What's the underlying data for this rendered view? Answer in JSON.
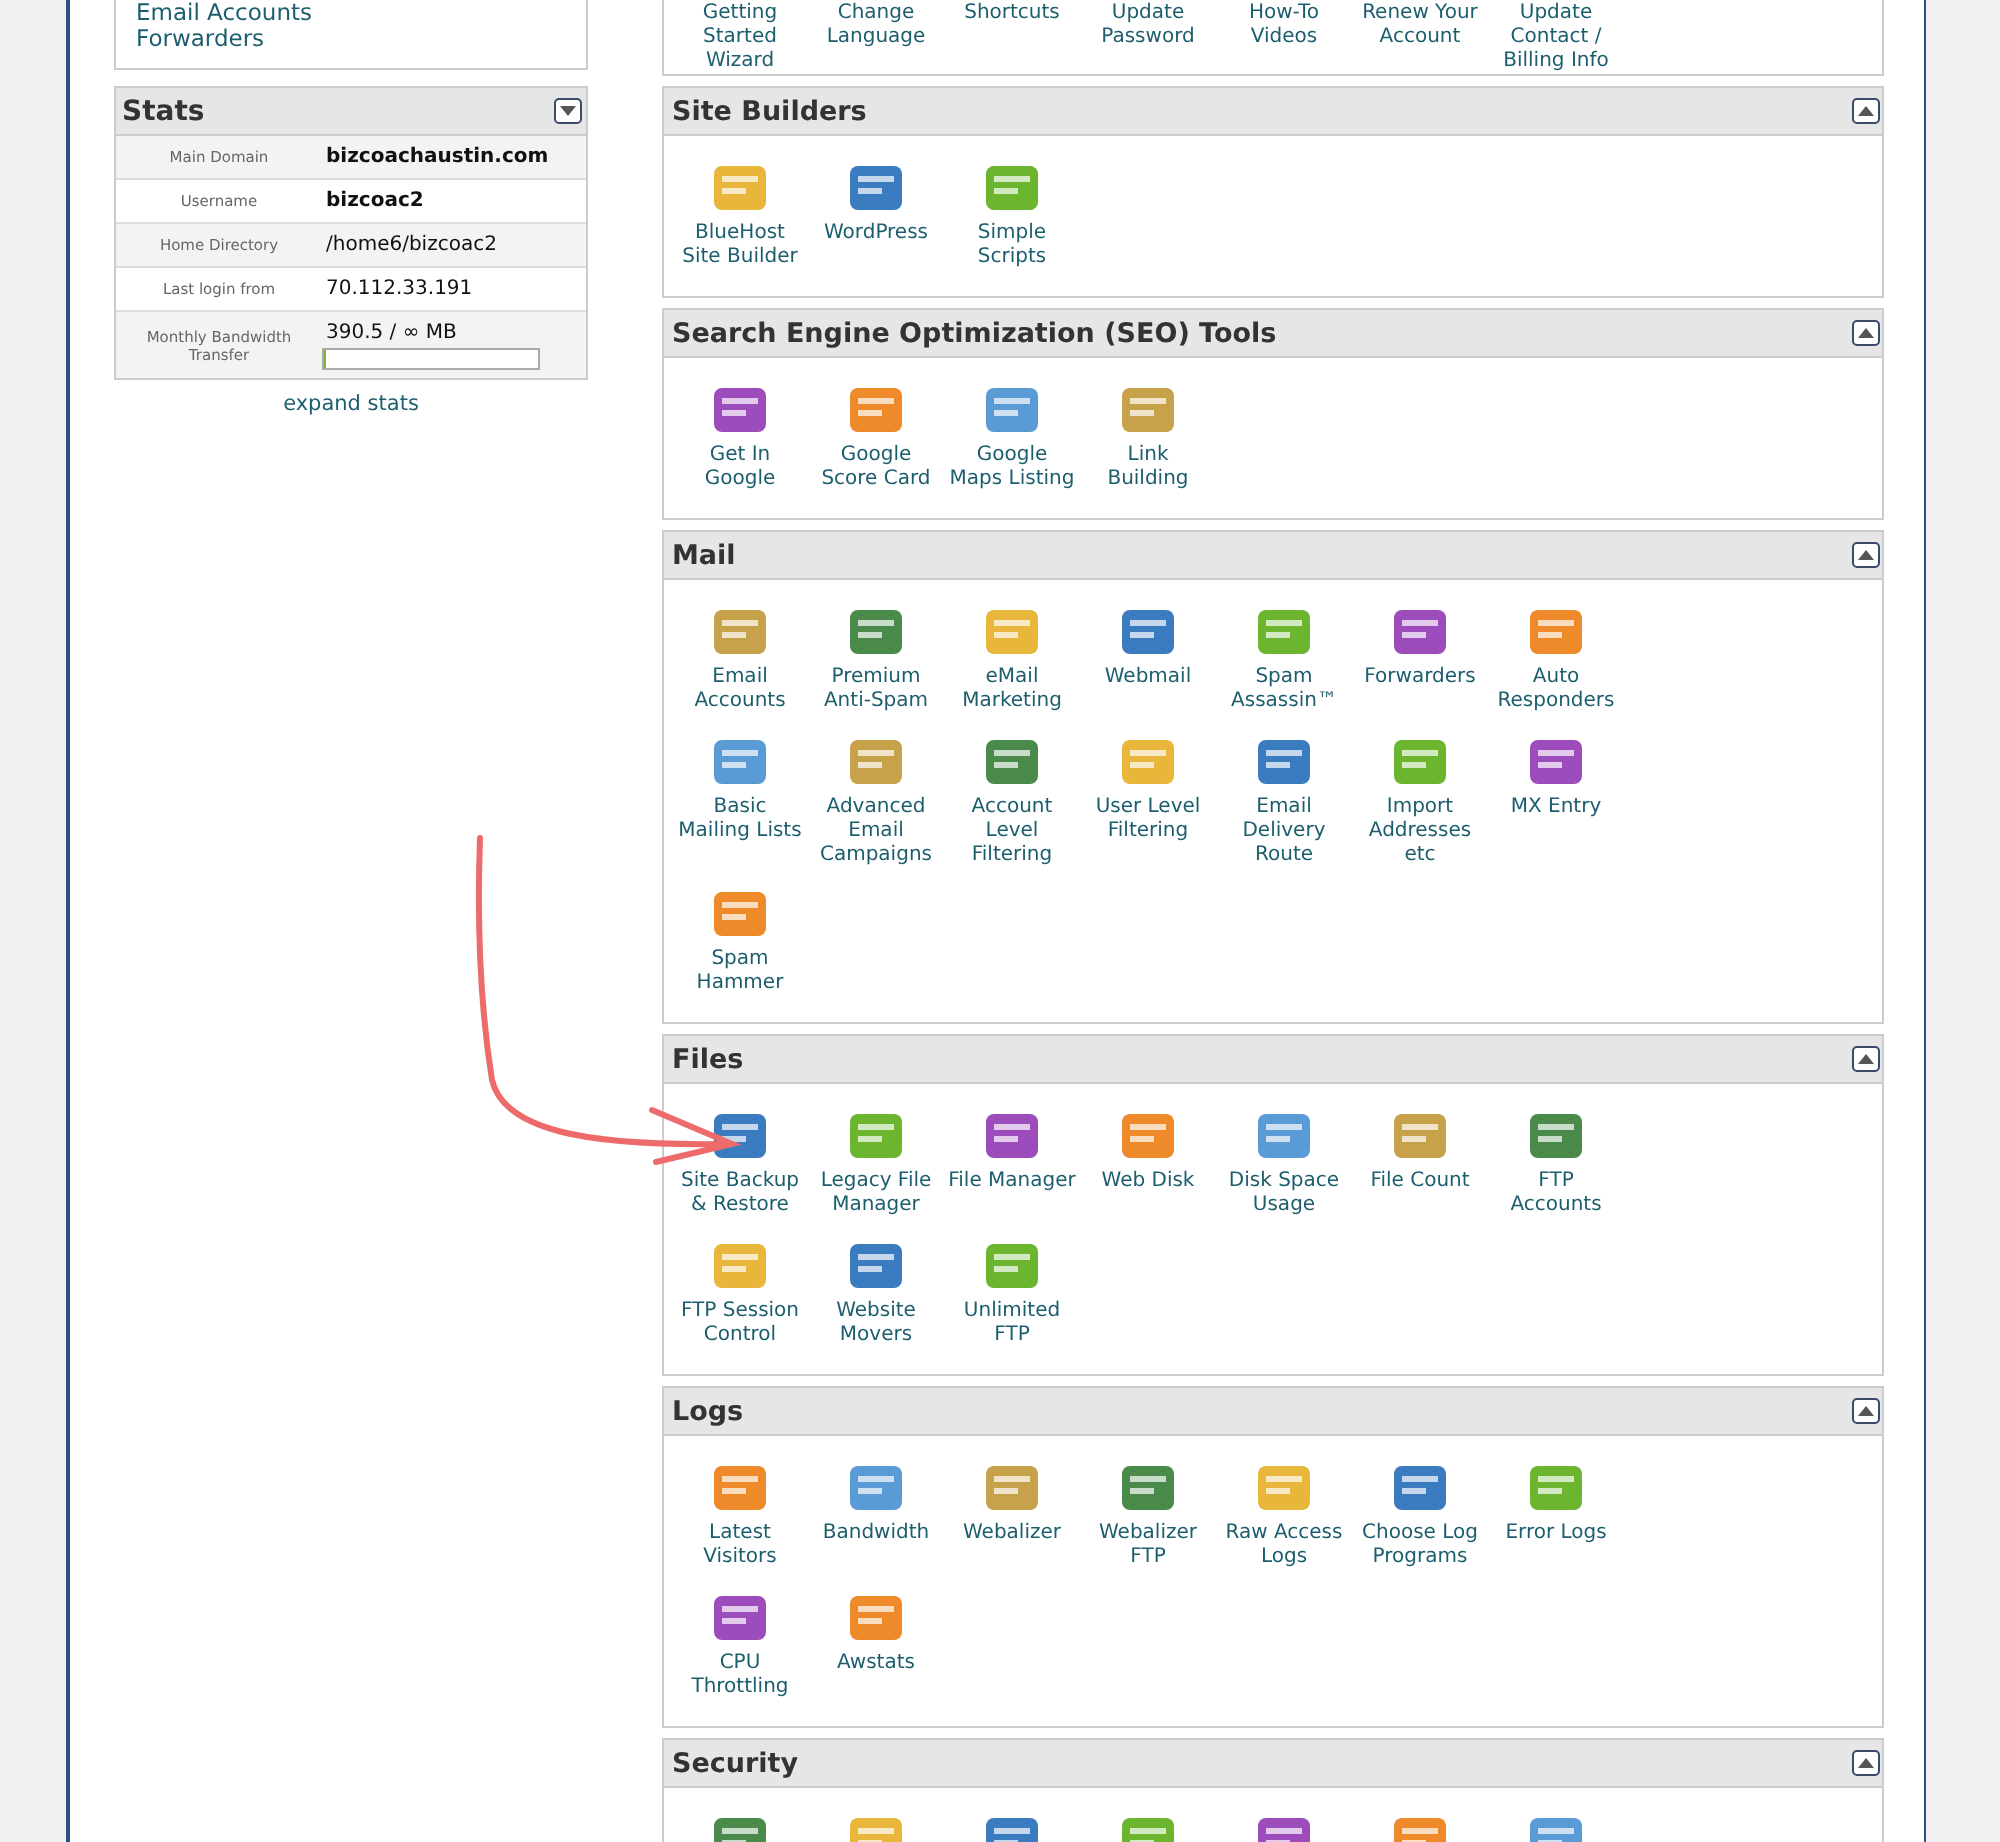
{
  "sidebar_links": [
    "Email Accounts",
    "Forwarders"
  ],
  "stats": {
    "title": "Stats",
    "expanded": false,
    "rows": [
      {
        "label": "Main Domain",
        "value": "bizcoachaustin.com",
        "bold": true
      },
      {
        "label": "Username",
        "value": "bizcoac2",
        "bold": true
      },
      {
        "label": "Home Directory",
        "value": "/home6/bizcoac2",
        "bold": false
      },
      {
        "label": "Last login from",
        "value": "70.112.33.191",
        "bold": false
      },
      {
        "label": "Monthly Bandwidth Transfer",
        "value": "390.5 / ∞ MB",
        "bold": false,
        "level": 0
      }
    ],
    "expand_link": "expand stats"
  },
  "top_items": [
    "Getting Started Wizard",
    "Change Language",
    "Shortcuts",
    "Update Password",
    "How-To Videos",
    "Renew Your Account",
    "Update Contact / Billing Info"
  ],
  "sections": [
    {
      "title": "Site Builders",
      "expanded": true,
      "items": [
        "BlueHost Site Builder",
        "WordPress",
        "Simple Scripts"
      ]
    },
    {
      "title": "Search Engine Optimization (SEO) Tools",
      "expanded": true,
      "items": [
        "Get In Google",
        "Google Score Card",
        "Google Maps Listing",
        "Link Building"
      ]
    },
    {
      "title": "Mail",
      "expanded": true,
      "items": [
        "Email Accounts",
        "Premium Anti-Spam",
        "eMail Marketing",
        "Webmail",
        "Spam Assassin™",
        "Forwarders",
        "Auto Responders",
        "Basic Mailing Lists",
        "Advanced Email Campaigns",
        "Account Level Filtering",
        "User Level Filtering",
        "Email Delivery Route",
        "Import Addresses etc",
        "MX Entry",
        "Spam Hammer"
      ]
    },
    {
      "title": "Files",
      "expanded": true,
      "items": [
        "Site Backup & Restore",
        "Legacy File Manager",
        "File Manager",
        "Web Disk",
        "Disk Space Usage",
        "File Count",
        "FTP Accounts",
        "FTP Session Control",
        "Website Movers",
        "Unlimited FTP"
      ]
    },
    {
      "title": "Logs",
      "expanded": true,
      "items": [
        "Latest Visitors",
        "Bandwidth",
        "Webalizer",
        "Webalizer FTP",
        "Raw Access Logs",
        "Choose Log Programs",
        "Error Logs",
        "CPU Throttling",
        "Awstats"
      ]
    },
    {
      "title": "Security",
      "expanded": true
    }
  ]
}
